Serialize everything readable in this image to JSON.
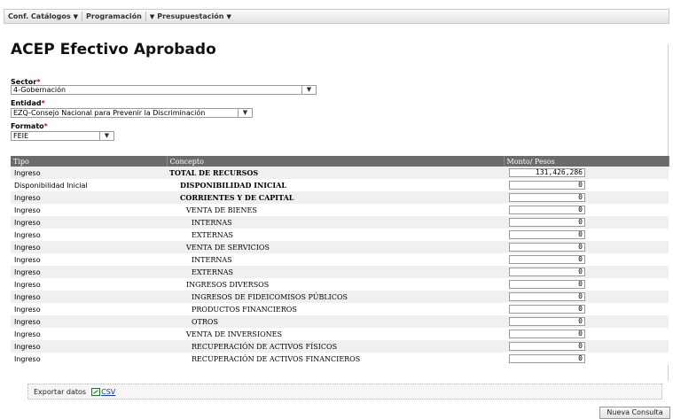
{
  "menu": {
    "items": [
      {
        "label": "Conf. Catálogos"
      },
      {
        "label": "Programación"
      },
      {
        "label": "Presupuestación"
      }
    ]
  },
  "page": {
    "title": "ACEP Efectivo Aprobado"
  },
  "filters": {
    "sector": {
      "label": "Sector",
      "required": "*",
      "value": "4-Gobernación"
    },
    "entidad": {
      "label": "Entidad",
      "required": "*",
      "value": "EZQ-Consejo Nacional para Prevenir la Discriminación"
    },
    "formato": {
      "label": "Formato",
      "required": "*",
      "value": "FEIE"
    }
  },
  "table": {
    "columns": [
      "Tipo",
      "Concepto",
      "Monto/ Pesos"
    ],
    "rows": [
      {
        "tipo": "Ingreso",
        "concepto": "TOTAL DE RECURSOS",
        "level": 0,
        "monto": "131,426,286"
      },
      {
        "tipo": "Disponibilidad Inicial",
        "concepto": "DISPONIBILIDAD INICIAL",
        "level": 1,
        "monto": "0"
      },
      {
        "tipo": "Ingreso",
        "concepto": "CORRIENTES Y DE CAPITAL",
        "level": 1,
        "monto": "0"
      },
      {
        "tipo": "Ingreso",
        "concepto": "VENTA DE BIENES",
        "level": 2,
        "monto": "0"
      },
      {
        "tipo": "Ingreso",
        "concepto": "INTERNAS",
        "level": 3,
        "monto": "0"
      },
      {
        "tipo": "Ingreso",
        "concepto": "EXTERNAS",
        "level": 3,
        "monto": "0"
      },
      {
        "tipo": "Ingreso",
        "concepto": "VENTA DE SERVICIOS",
        "level": 2,
        "monto": "0"
      },
      {
        "tipo": "Ingreso",
        "concepto": "INTERNAS",
        "level": 3,
        "monto": "0"
      },
      {
        "tipo": "Ingreso",
        "concepto": "EXTERNAS",
        "level": 3,
        "monto": "0"
      },
      {
        "tipo": "Ingreso",
        "concepto": "INGRESOS DIVERSOS",
        "level": 2,
        "monto": "0"
      },
      {
        "tipo": "Ingreso",
        "concepto": "INGRESOS DE FIDEICOMISOS PÚBLICOS",
        "level": 3,
        "monto": "0"
      },
      {
        "tipo": "Ingreso",
        "concepto": "PRODUCTOS FINANCIEROS",
        "level": 3,
        "monto": "0"
      },
      {
        "tipo": "Ingreso",
        "concepto": "OTROS",
        "level": 3,
        "monto": "0"
      },
      {
        "tipo": "Ingreso",
        "concepto": "VENTA DE INVERSIONES",
        "level": 2,
        "monto": "0"
      },
      {
        "tipo": "Ingreso",
        "concepto": "RECUPERACIÓN DE ACTIVOS FÍSICOS",
        "level": 3,
        "monto": "0"
      },
      {
        "tipo": "Ingreso",
        "concepto": "RECUPERACIÓN DE ACTIVOS FINANCIEROS",
        "level": 3,
        "monto": "0"
      }
    ]
  },
  "export": {
    "label": "Exportar datos",
    "csv": "CSV",
    "icon": "csv-file-icon"
  },
  "actions": {
    "new_query": "Nueva Consulta"
  }
}
